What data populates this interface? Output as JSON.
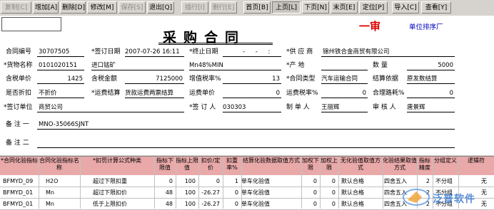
{
  "toolbar": {
    "buttons": [
      {
        "label": "复制[C]",
        "state": "disabled"
      },
      {
        "label": "增加[A]",
        "state": "normal"
      },
      {
        "label": "删除[D]",
        "state": "normal"
      },
      {
        "label": "修改[M]",
        "state": "normal"
      },
      {
        "label": "保存[S]",
        "state": "disabled"
      },
      {
        "label": "退出[Q]",
        "state": "normal"
      },
      {
        "label": "插行[I]",
        "state": "disabled"
      },
      {
        "label": "删行[E]",
        "state": "disabled"
      },
      {
        "label": "首页[B]",
        "state": "normal"
      },
      {
        "label": "上页[L]",
        "state": "pressed"
      },
      {
        "label": "下页[N]",
        "state": "normal"
      },
      {
        "label": "末页[E]",
        "state": "normal"
      },
      {
        "label": "定位[P]",
        "state": "normal"
      },
      {
        "label": "导入[C]",
        "state": "normal"
      },
      {
        "label": "查看[Y]",
        "state": "normal"
      }
    ]
  },
  "header": {
    "title": "采购合同",
    "stamp": "一审",
    "sort_label": "单位排序厂"
  },
  "form": {
    "contract_no_label": "合同编号",
    "contract_no": "30707505",
    "sign_date_label": "*签订日期",
    "sign_date": "2007-07-26 16:11",
    "end_date_label": "*终止日期",
    "end_date": "- - :",
    "supplier_label": "*供 应 商",
    "supplier": "锦州铁合金商贸有限公司",
    "goods_name_label": "*货物名称",
    "goods_code": "0101020151",
    "goods_name": "进口锰矿",
    "goods_spec": "Mn48%MIN",
    "origin_label": "*产 地",
    "origin": "",
    "quantity_label": "数 量",
    "quantity": "5000",
    "tax_price_label": "含税单价",
    "tax_price": "1425",
    "tax_amount_label": "含税金额",
    "tax_amount": "7125000",
    "vat_label": "增值税率%",
    "vat": "13",
    "contract_type_label": "*合同类型",
    "contract_type": "汽车运输合同",
    "settle_basis_label": "结算依据",
    "settle_basis": "原发数结算",
    "discount_label": "是否折扣",
    "discount": "不折价",
    "freight_settle_label": "*运费结算",
    "freight_settle": "货款运费两票结算",
    "freight_price_label": "运费单价",
    "freight_price": "0",
    "freight_tax_label": "运费税率%",
    "freight_tax": "0",
    "distance_label": "合理路耗%",
    "distance": "0",
    "sign_unit_label": "*签订单位",
    "sign_unit": "商贸公司",
    "signer_label": "*签 订 人",
    "signer": "030303",
    "maker_label": "制 单 人",
    "maker": "王丽辉",
    "auditor_label": "审 核 人",
    "auditor": "唐景辉",
    "remark1_label": "备 注 一",
    "remark1": "MNO-35066SJNT",
    "remark2_label": "备 注 二",
    "remark2": ""
  },
  "grid": {
    "headers": [
      "*合同化验指标",
      "合同化验指标名称",
      "*扣罚计算公式种类",
      "指标下限值",
      "指标上限值",
      "扣价/定价",
      "扣重率%",
      "结算化验数据取值方式",
      "加权下限",
      "加权上限",
      "无化验值取值方式",
      "化验结果取值方式",
      "指标精度",
      "分组定义",
      "逻辑符"
    ],
    "rows": [
      [
        "BFMYD_09",
        "H2O",
        "超过下限扣重",
        "0",
        "100",
        "0",
        "1",
        "单车化验值",
        "0",
        "0",
        "默认合格",
        "四舍五入",
        "2",
        "不分组",
        "无"
      ],
      [
        "BFMYD_01",
        "Mn",
        "超过下限扣价",
        "48",
        "100",
        "-26.27",
        "0",
        "单车化验值",
        "0",
        "0",
        "默认合格",
        "四舍五入",
        "2",
        "不分组",
        "无"
      ],
      [
        "BFMYD_01",
        "Mn",
        "低于上限扣价",
        "48",
        "100",
        "-26.27",
        "0",
        "单车化验值",
        "0",
        "0",
        "默认合格",
        "四舍五入",
        "2",
        "不分组",
        "无"
      ]
    ]
  },
  "watermark": "泛普软件",
  "colors": {
    "grid_header": "#e9a9a9",
    "stamp": "#e00000",
    "sort_label": "#0000c0"
  }
}
